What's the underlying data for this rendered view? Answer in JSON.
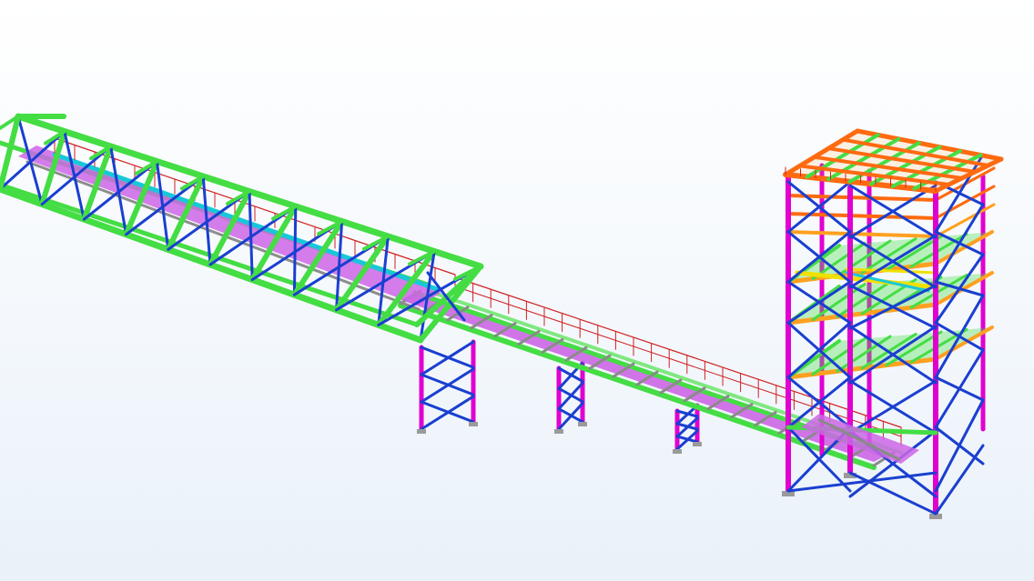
{
  "scene": {
    "type": "3d-structural-steel-model",
    "subject": "conveyor-gallery-and-transfer-tower",
    "background": "#f4f8fc"
  },
  "colors": {
    "truss_chord": "#44dd44",
    "bracing": "#1a3fd0",
    "column": "#e000d0",
    "conveyor_deck": "#cc66e6",
    "handrail": "#d02020",
    "beam_orange": "#ff6a10",
    "beam_light_orange": "#ffa020",
    "beam_yellow": "#f0e000",
    "walkway_cyan": "#18c8d8",
    "base_plate": "#9a9a9a"
  },
  "components": [
    {
      "id": "inclined-truss-gallery",
      "color_key": "truss_chord"
    },
    {
      "id": "open-conveyor-span",
      "color_key": "conveyor_deck"
    },
    {
      "id": "support-trestles",
      "color_key": "column"
    },
    {
      "id": "transfer-tower",
      "color_key": "column"
    },
    {
      "id": "tower-roof-grid",
      "color_key": "beam_orange"
    }
  ]
}
